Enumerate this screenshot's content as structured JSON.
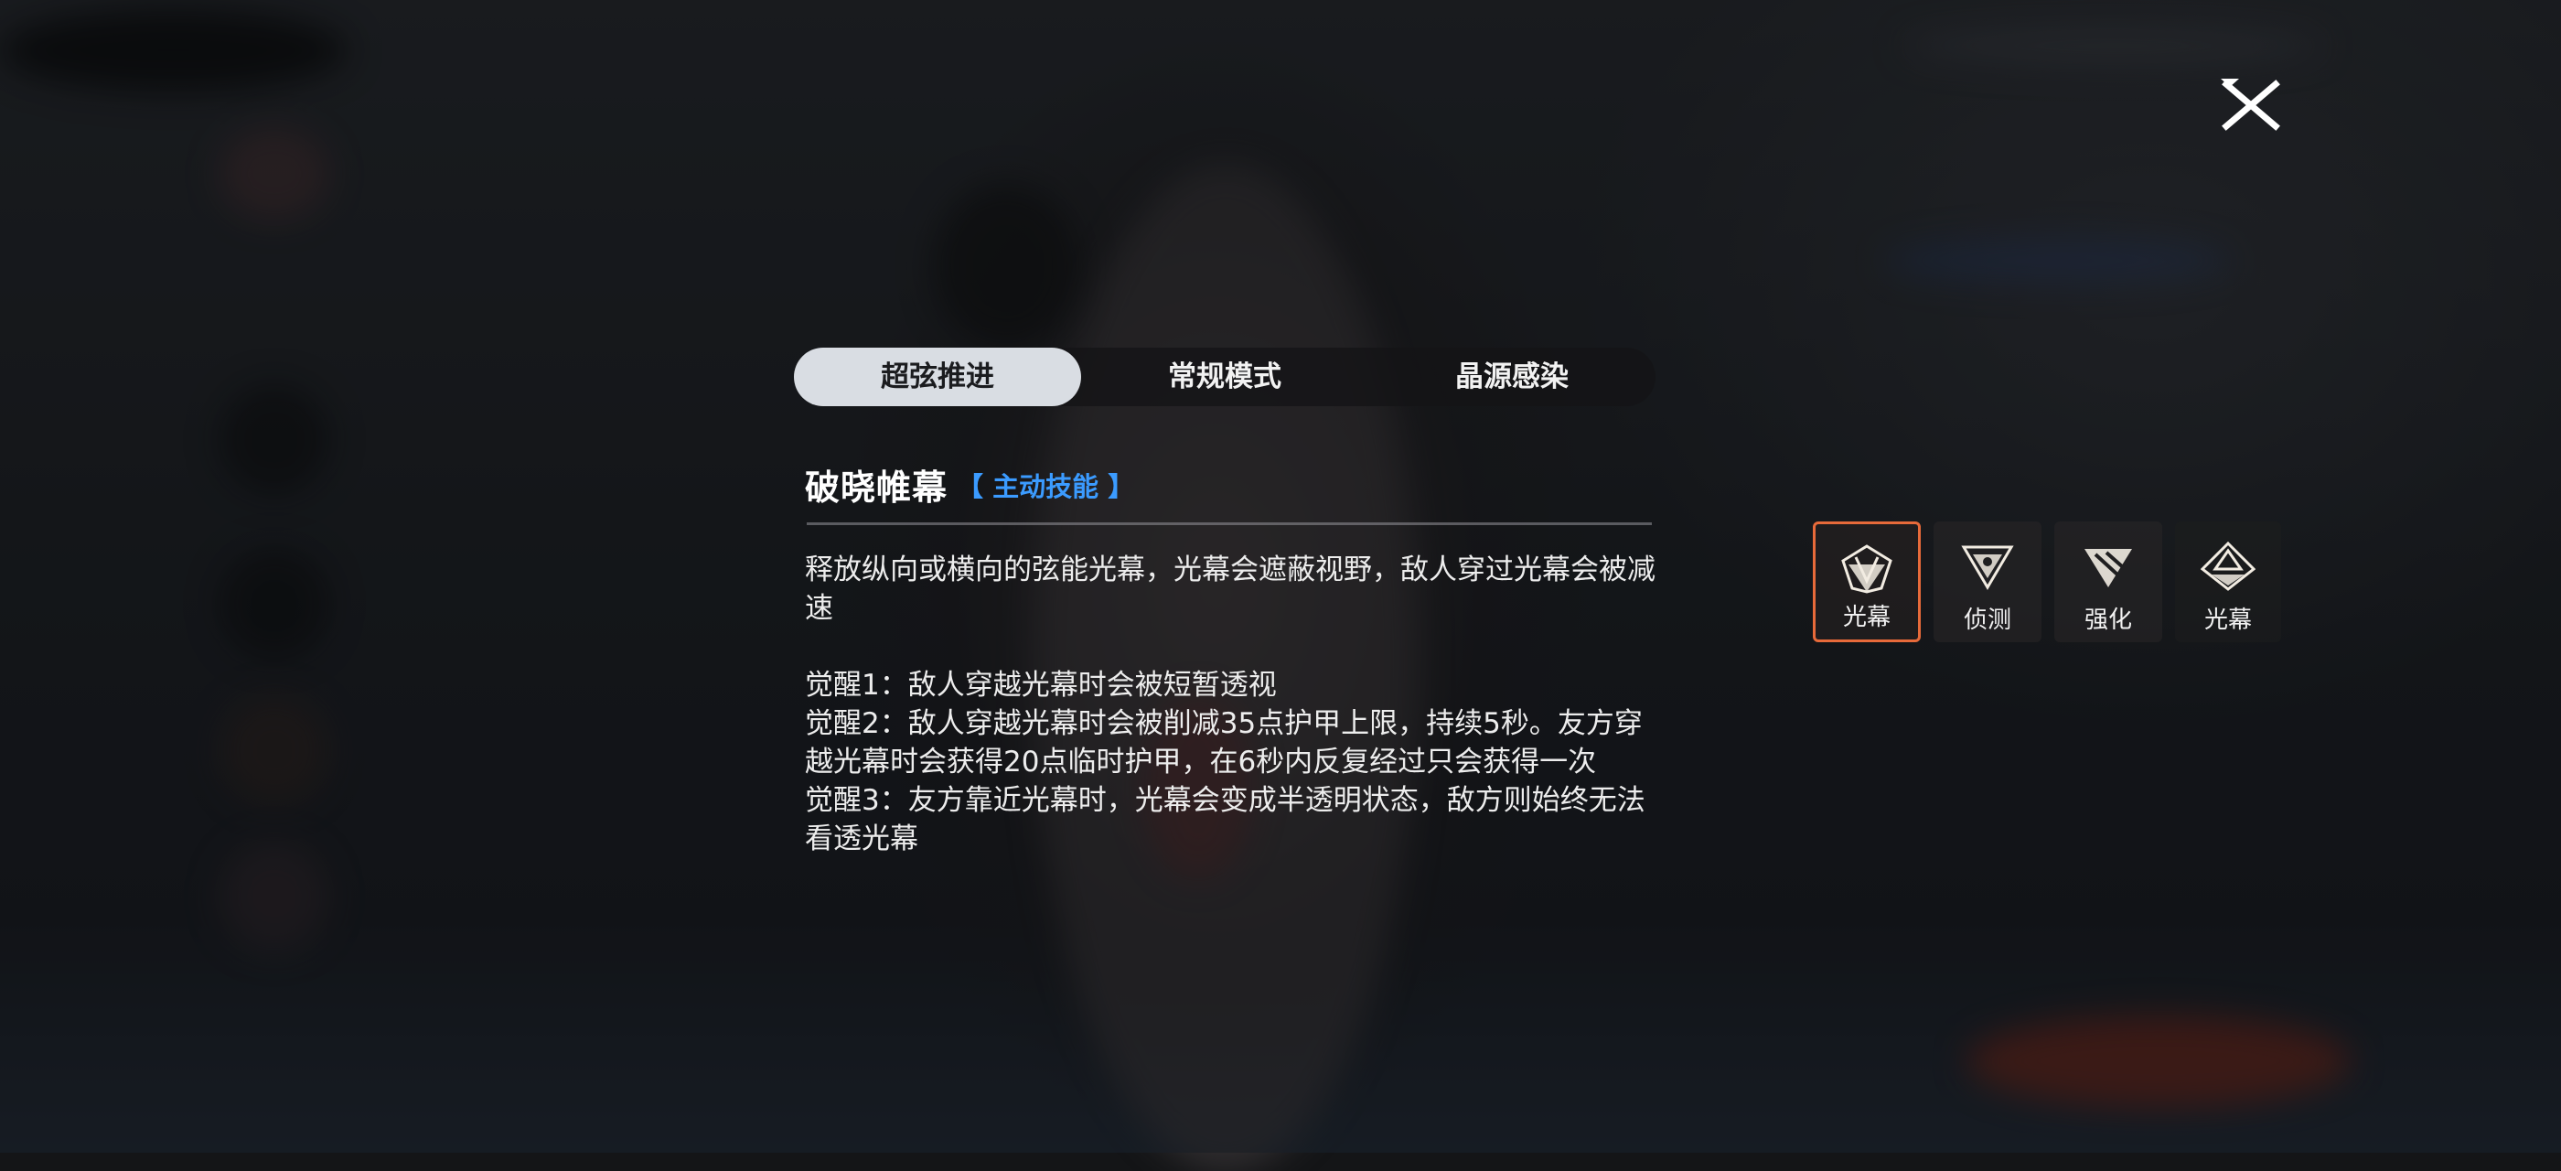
{
  "tabs": [
    {
      "label": "超弦推进",
      "active": true
    },
    {
      "label": "常规模式",
      "active": false
    },
    {
      "label": "晶源感染",
      "active": false
    }
  ],
  "skill": {
    "name": "破晓帷幕",
    "type_label": "【 主动技能 】",
    "description": "释放纵向或横向的弦能光幕，光幕会遮蔽视野，敌人穿过光幕会被减速",
    "awaken": [
      "觉醒1：敌人穿越光幕时会被短暂透视",
      "觉醒2：敌人穿越光幕时会被削减35点护甲上限，持续5秒。友方穿越光幕时会获得20点临时护甲，在6秒内反复经过只会获得一次",
      "觉醒3：友方靠近光幕时，光幕会变成半透明状态，敌方则始终无法看透光幕"
    ]
  },
  "skill_icons": [
    {
      "label": "光幕",
      "icon": "curtain-icon",
      "selected": true
    },
    {
      "label": "侦测",
      "icon": "detect-icon",
      "selected": false
    },
    {
      "label": "强化",
      "icon": "enhance-icon",
      "selected": false
    },
    {
      "label": "光幕",
      "icon": "curtain-ultimate-icon",
      "selected": false
    }
  ],
  "colors": {
    "accent_blue": "#3b9bff",
    "selected_border": "#e76a3a",
    "active_tab_bg": "#d9dde3"
  }
}
